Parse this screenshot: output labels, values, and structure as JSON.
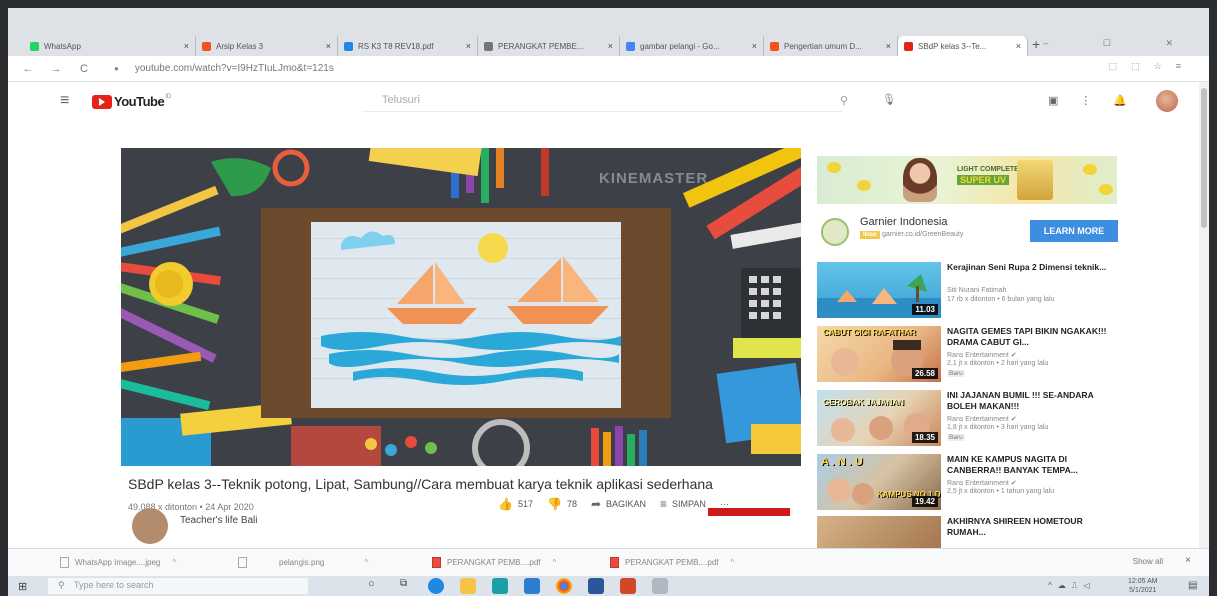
{
  "browser": {
    "tabs": [
      {
        "title": "WhatsApp",
        "color": "#25d366"
      },
      {
        "title": "Arsip Kelas 3",
        "color": "#f4511e"
      },
      {
        "title": "RS K3 T8 REV18.pdf",
        "color": "#1e88e5"
      },
      {
        "title": "PERANGKAT PEMBE...",
        "color": "#757575"
      },
      {
        "title": "gambar pelangi - Go...",
        "color": "#4285f4"
      },
      {
        "title": "Pengertian umum D...",
        "color": "#f4511e"
      },
      {
        "title": "SBdP kelas 3--Te...",
        "color": "#e62117",
        "active": true
      }
    ],
    "close_glyph": "×",
    "new_tab": "+",
    "window_controls": "– ☐ ✕",
    "url": "youtube.com/watch?v=I9HzTIuLJmo&t=121s",
    "back": "←",
    "forward": "→",
    "reload": "C",
    "lock": "●"
  },
  "youtube": {
    "logo": "YouTube",
    "region": "ID",
    "search_placeholder": "Telusuri",
    "watermark": "KINEMASTER",
    "video_title": "SBdP kelas 3--Teknik potong, Lipat, Sambung//Cara membuat karya teknik aplikasi sederhana",
    "video_meta": "49.088 x ditonton • 24 Apr 2020",
    "likes": "517",
    "dislikes": "78",
    "share": "BAGIKAN",
    "save": "SIMPAN",
    "more": "···",
    "channel": "Teacher's life Bali"
  },
  "ad": {
    "banner_line1": "LIGHT COMPLETE",
    "banner_line2": "SUPER UV",
    "title": "Garnier Indonesia",
    "badge": "Iklan",
    "url": "garnier.co.id/GreenBeauty",
    "cta": "LEARN MORE"
  },
  "recommendations": [
    {
      "title": "Kerajinan Seni Rupa 2 Dimensi teknik...",
      "channel": "Siti Nurani Fatimah",
      "meta": "17 rb x ditonton • 6 bulan yang lalu",
      "duration": "11.03",
      "badge": ""
    },
    {
      "title": "NAGITA GEMES TAPI BIKIN NGAKAK!!! DRAMA CABUT GI...",
      "channel": "Rans Entertainment ✔",
      "meta": "2,1 jt x ditonton • 2 hari yang lalu",
      "duration": "26.58",
      "badge": "Baru",
      "thumb_text": "CABUT GIGI RAFATHAR"
    },
    {
      "title": "INI JAJANAN BUMIL !!! SE-ANDARA BOLEH MAKAN!!!",
      "channel": "Rans Entertainment ✔",
      "meta": "1,8 jt x ditonton • 3 hari yang lalu",
      "duration": "18.35",
      "badge": "Baru",
      "thumb_text": "GEROBAK JAJANAN"
    },
    {
      "title": "MAIN KE KAMPUS NAGITA DI CANBERRA!! BANYAK TEMPA...",
      "channel": "Rans Entertainment ✔",
      "meta": "2,5 jt x ditonton • 1 tahun yang lalu",
      "duration": "19.42",
      "badge": "",
      "thumb_text": "KAMPUS NO 1 DI AUSTI"
    },
    {
      "title": "AKHIRNYA SHIREEN HOMETOUR RUMAH...",
      "channel": "",
      "meta": "",
      "duration": "",
      "badge": ""
    }
  ],
  "downloads": [
    {
      "name": "WhatsApp Image....jpeg",
      "type": "img"
    },
    {
      "name": "pelangis.png",
      "type": "img"
    },
    {
      "name": "PERANGKAT PEMB....pdf",
      "type": "pdf"
    },
    {
      "name": "PERANGKAT PEMB....pdf",
      "type": "pdf"
    }
  ],
  "downloads_caret": "^",
  "show_all": "Show all",
  "taskbar": {
    "search_placeholder": "Type here to search",
    "time": "12:05 AM",
    "date": "5/1/2021"
  }
}
